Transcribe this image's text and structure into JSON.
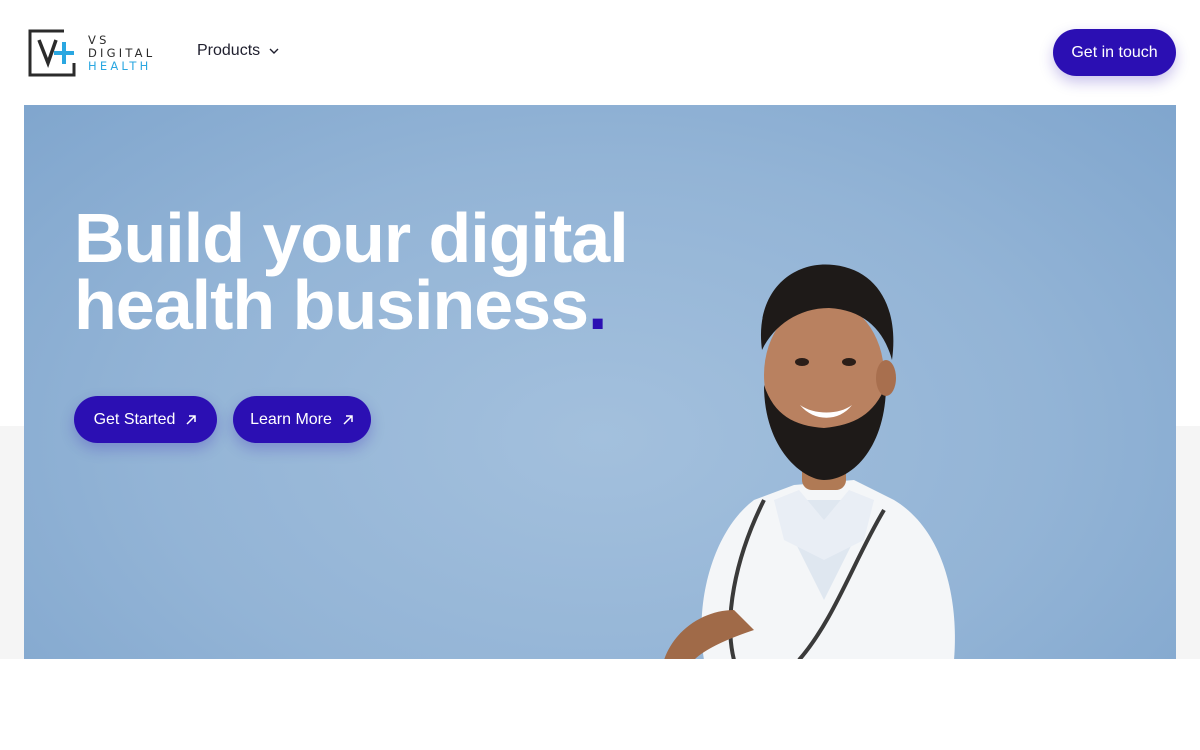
{
  "brand": {
    "line1": "VS",
    "line2": "DIGITAL",
    "line3": "HEALTH",
    "accent_color": "#2aa7e1"
  },
  "nav": {
    "products_label": "Products"
  },
  "header": {
    "cta_label": "Get in touch"
  },
  "hero": {
    "title_line1": "Build your digital",
    "title_line2": "health business",
    "title_dot": ".",
    "primary_cta": "Get Started",
    "secondary_cta": "Learn More",
    "background_color": "#93b4d6"
  },
  "colors": {
    "primary_button": "#2b0fb3",
    "text_white": "#ffffff"
  },
  "icons": {
    "logo": "vs-plus-logo-icon",
    "products_chevron": "chevron-down-icon",
    "cta_arrow": "arrow-up-right-icon"
  }
}
